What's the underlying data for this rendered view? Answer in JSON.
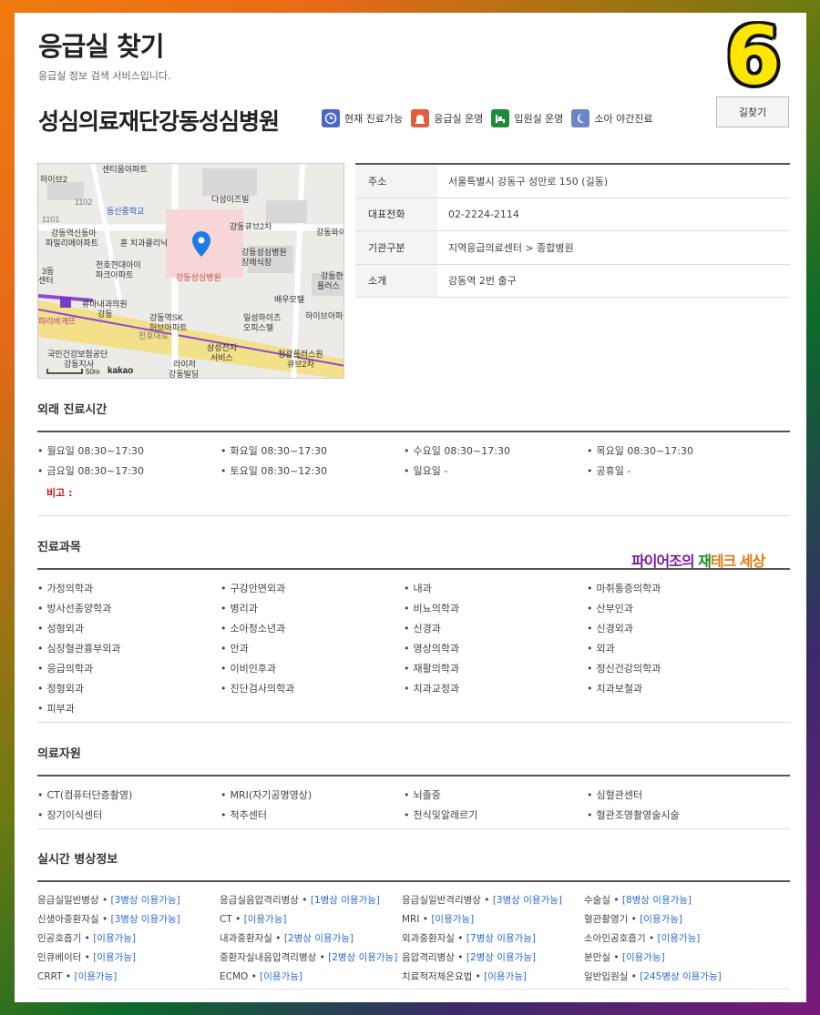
{
  "header": {
    "title": "응급실 찾기",
    "subtitle": "응급실 정보 검색 서비스입니다.",
    "badge": "6"
  },
  "hospital": {
    "name": "성심의료재단강동성심병원",
    "route_button": "길찾기",
    "status": [
      {
        "label": "현재 진료가능",
        "icon": "clock-icon",
        "color": "#4a67c8"
      },
      {
        "label": "응급실 운영",
        "icon": "siren-icon",
        "color": "#e25d3d"
      },
      {
        "label": "입원실 운영",
        "icon": "bed-icon",
        "color": "#1f8a3a"
      },
      {
        "label": "소아 야간진료",
        "icon": "moon-icon",
        "color": "#6a85c8"
      }
    ]
  },
  "map": {
    "brand": "kakao",
    "scale": "50m",
    "labels": [
      "센티움아파트",
      "하이브2",
      "1102",
      "다성이즈빌",
      "동신중학교",
      "1101",
      "강동큐브2차",
      "강동와이",
      "강동역신동아",
      "파밀리에아파트",
      "훈 치과클리닉",
      "강동성심병원",
      "장례식장",
      "강동성심병원",
      "3동",
      "센터",
      "천호현대아이",
      "파크아파트",
      "강동한",
      "플러스",
      "류마내과의원",
      "배우모텔",
      "강동",
      "하이브아파",
      "파리바게뜨",
      "강동역SK",
      "허브아파트",
      "일성하이츠",
      "오피스텔",
      "천호대로",
      "삼성전자",
      "서비스",
      "국민건강보험공단",
      "강동지사",
      "청광플러스원",
      "큐브2차",
      "라이저",
      "강동빌딩"
    ]
  },
  "info": [
    {
      "key": "주소",
      "value": "서울특별시 강동구 성안로 150 (길동)"
    },
    {
      "key": "대표전화",
      "value": "02-2224-2114"
    },
    {
      "key": "기관구분",
      "value": "지역응급의료센터 > 종합병원"
    },
    {
      "key": "소개",
      "value": "강동역 2번 출구"
    }
  ],
  "hours": {
    "title": "외래 진료시간",
    "items": [
      "월요일 08:30~17:30",
      "화요일 08:30~17:30",
      "수요일 08:30~17:30",
      "목요일 08:30~17:30",
      "금요일 08:30~17:30",
      "토요일 08:30~12:30",
      "일요일  -",
      "공휴일 -"
    ],
    "note": "비고 :"
  },
  "departments": {
    "title": "진료과목",
    "items": [
      "가정의학과",
      "구강안면외과",
      "내과",
      "마취통증의학과",
      "방사선종양학과",
      "병리과",
      "비뇨의학과",
      "산부인과",
      "성형외과",
      "소아청소년과",
      "신경과",
      "신경외과",
      "심장혈관흉부외과",
      "안과",
      "영상의학과",
      "외과",
      "응급의학과",
      "이비인후과",
      "재활의학과",
      "정신건강의학과",
      "정형외과",
      "진단검사의학과",
      "치과교정과",
      "치과보철과",
      "피부과"
    ]
  },
  "watermark": {
    "part1": "파이어조의 ",
    "part2": "재",
    "part3": "테크 세상"
  },
  "resources": {
    "title": "의료자원",
    "items": [
      "CT(컴퓨터단층촬영)",
      "MRI(자기공명영상)",
      "뇌졸중",
      "심혈관센터",
      "장기이식센터",
      "척추센터",
      "천식및알레르기",
      "혈관조영촬영술시술"
    ]
  },
  "beds": {
    "title": "실시간 병상정보",
    "items": [
      {
        "name": "응급실일반병상",
        "status": "[3병상 이용가능]"
      },
      {
        "name": "응급실음압격리병상",
        "status": "[1병상 이용가능]"
      },
      {
        "name": "응급실일반격리병상",
        "status": "[3병상 이용가능]"
      },
      {
        "name": "수술실",
        "status": "[8병상 이용가능]"
      },
      {
        "name": "신생아중환자실",
        "status": "[3병상 이용가능]"
      },
      {
        "name": "CT",
        "status": "[이용가능]"
      },
      {
        "name": "MRI",
        "status": "[이용가능]"
      },
      {
        "name": "혈관촬영기",
        "status": "[이용가능]"
      },
      {
        "name": "인공호흡기",
        "status": "[이용가능]"
      },
      {
        "name": "내과중환자실",
        "status": "[2병상 이용가능]"
      },
      {
        "name": "외과중환자실",
        "status": "[7병상 이용가능]"
      },
      {
        "name": "소아인공호흡기",
        "status": "[이용가능]"
      },
      {
        "name": "인큐베이터",
        "status": "[이용가능]"
      },
      {
        "name": "중환자실내음압격리병상",
        "status": "[2병상 이용가능]"
      },
      {
        "name": "음압격리병상",
        "status": "[2병상 이용가능]"
      },
      {
        "name": "분만실",
        "status": "[이용가능]"
      },
      {
        "name": "CRRT",
        "status": "[이용가능]"
      },
      {
        "name": "ECMO",
        "status": "[이용가능]"
      },
      {
        "name": "치료적저체온요법",
        "status": "[이용가능]"
      },
      {
        "name": "일반입원실",
        "status": "[245병상 이용가능]"
      }
    ]
  }
}
